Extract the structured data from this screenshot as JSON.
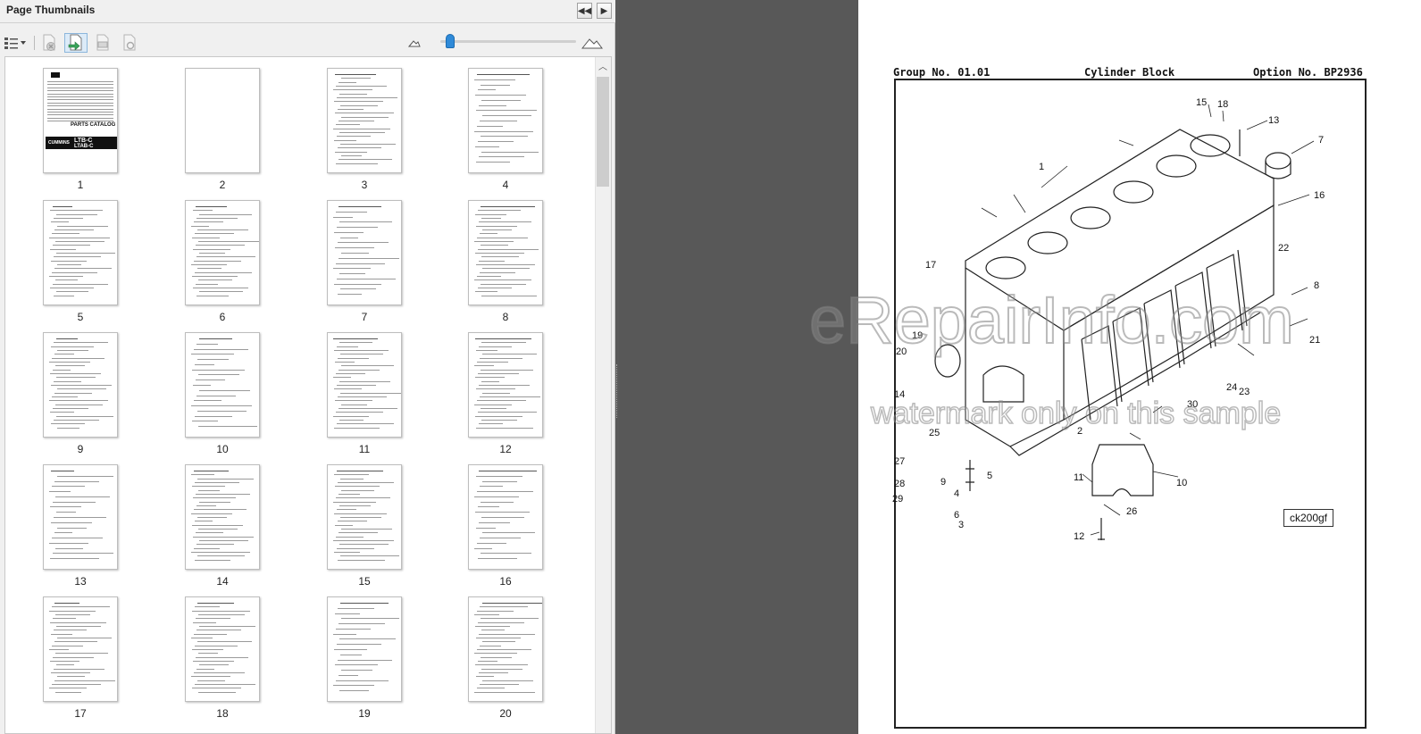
{
  "panel": {
    "title": "Page Thumbnails",
    "collapse_label": "◀◀",
    "expand_label": "▶",
    "zoom_level": 0.05
  },
  "thumbnails": [
    {
      "page": "1"
    },
    {
      "page": "2"
    },
    {
      "page": "3"
    },
    {
      "page": "4"
    },
    {
      "page": "5"
    },
    {
      "page": "6"
    },
    {
      "page": "7"
    },
    {
      "page": "8"
    },
    {
      "page": "9"
    },
    {
      "page": "10"
    },
    {
      "page": "11"
    },
    {
      "page": "12"
    },
    {
      "page": "13"
    },
    {
      "page": "14"
    },
    {
      "page": "15"
    },
    {
      "page": "16"
    },
    {
      "page": "17"
    },
    {
      "page": "18"
    },
    {
      "page": "19"
    },
    {
      "page": "20"
    }
  ],
  "cover": {
    "brand": "Kawasaki",
    "catalog": "PARTS CATALOG",
    "engine": "LTB-C",
    "engine2": "LTAB-C",
    "maker": "CUMMINS"
  },
  "document": {
    "group": "Group No. 01.01",
    "title": "Cylinder Block",
    "option": "Option No. BP2936",
    "code": "ck200gf",
    "watermark_main": "eRepairInfo.com",
    "watermark_sub": "watermark only on this sample",
    "callouts": [
      "1",
      "2",
      "3",
      "4",
      "5",
      "6",
      "7",
      "8",
      "9",
      "10",
      "11",
      "12",
      "13",
      "14",
      "15",
      "16",
      "17",
      "18",
      "19",
      "20",
      "21",
      "22",
      "23",
      "24",
      "25",
      "26",
      "27",
      "28",
      "29",
      "30"
    ]
  },
  "colors": {
    "panel_bg": "#f0f0f0",
    "viewer_bg": "#585858",
    "slider_thumb": "#2f8ad8"
  }
}
